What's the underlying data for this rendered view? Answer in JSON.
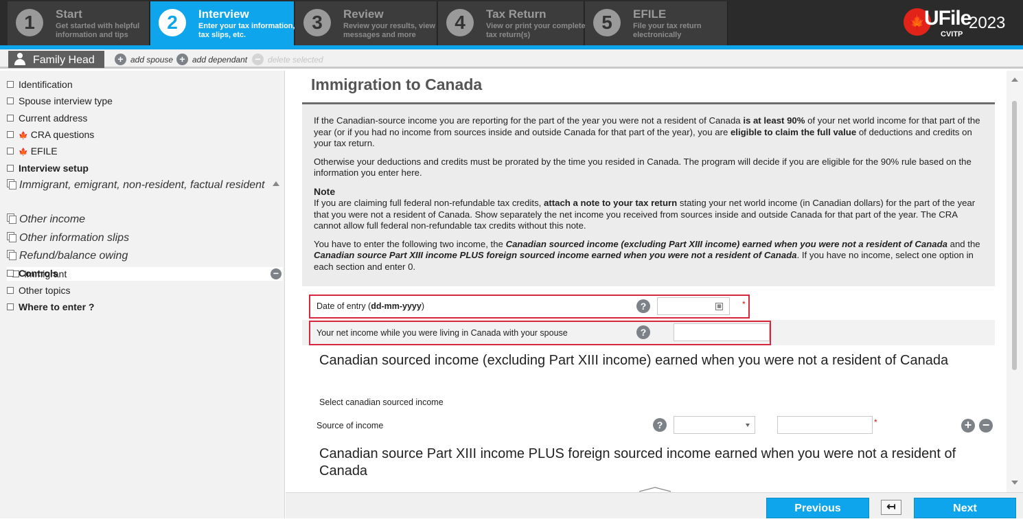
{
  "steps": [
    {
      "num": "1",
      "title": "Start",
      "desc": "Get started with helpful information and tips"
    },
    {
      "num": "2",
      "title": "Interview",
      "desc": "Enter your tax information, tax slips, etc."
    },
    {
      "num": "3",
      "title": "Review",
      "desc": "Review your results, view messages and more"
    },
    {
      "num": "4",
      "title": "Tax Return",
      "desc": "View or print your complete tax return(s)"
    },
    {
      "num": "5",
      "title": "EFILE",
      "desc": "File your tax return electronically"
    }
  ],
  "logo": {
    "brand": "UFile",
    "year": "2023",
    "edition": "CVITP",
    "leaf": "🍁"
  },
  "family": {
    "tab_label": "Family Head",
    "add_spouse": "add spouse",
    "add_dependant": "add dependant",
    "delete_selected": "delete selected"
  },
  "sidebar": {
    "identification": "Identification",
    "spouse_interview_type": "Spouse interview type",
    "current_address": "Current address",
    "cra_questions": "CRA questions",
    "efile": "EFILE",
    "interview_setup": "Interview setup",
    "immigrant_group": "Immigrant, emigrant, non-resident, factual resident",
    "immigrant": "Immigrant",
    "other_income": "Other income",
    "other_info_slips": "Other information slips",
    "refund_balance": "Refund/balance owing",
    "controls": "Controls",
    "other_topics": "Other topics",
    "where_to_enter": "Where to enter ?"
  },
  "main": {
    "title": "Immigration to Canada",
    "info": {
      "p1_a": "If the Canadian-source income you are reporting for the part of the year you were not a resident of Canada ",
      "p1_b": "is at least 90%",
      "p1_c": " of your net world income for that part of the year (or if you had no income from sources inside and outside Canada for that part of the year), you are ",
      "p1_d": "eligible to claim the full value",
      "p1_e": " of deductions and credits on your tax return.",
      "p2": "Otherwise your deductions and credits must be prorated by the time you resided in Canada. The program will decide if you are eligible for the 90% rule based on the information you enter here.",
      "note_title": "Note",
      "p3_a": " If you are claiming full federal non-refundable tax credits, ",
      "p3_b": "attach a note to your tax return",
      "p3_c": " stating your net world income (in Canadian dollars) for the part of the year that you were not a resident of Canada. Show separately the net income you received from sources inside and outside Canada for that part of the year. The CRA cannot allow full federal non-refundable tax credits without this note.",
      "p4_a": "You have to enter the following two income, the ",
      "p4_b": "Canadian sourced income (excluding Part XIII income) earned when you were not a resident of Canada",
      "p4_c": " and the ",
      "p4_d": "Canadian source Part XIII income PLUS foreign sourced income earned when you were not a resident of Canada",
      "p4_e": ". If you have no income, select one option in each section and enter 0."
    },
    "date_of_entry_label_a": "Date of entry (",
    "date_of_entry_label_b": "dd-mm-yyyy",
    "date_of_entry_label_c": ")",
    "date_of_entry_value": "",
    "net_income_label": "Your net income while you were living in Canada with your spouse",
    "net_income_value": "",
    "section1_title": "Canadian sourced income (excluding Part XIII income) earned when you were not a resident of Canada",
    "section1_subtitle": "Select canadian sourced income",
    "source_of_income_label": "Source of income",
    "source_select_value": "",
    "source_amount_value": "",
    "section2_title": "Canadian source Part XIII income PLUS foreign sourced income earned when you were not a resident of Canada",
    "help_glyph": "?",
    "required_mark": "*"
  },
  "bottom": {
    "previous": "Previous",
    "next": "Next",
    "back_glyph": "↤"
  },
  "colors": {
    "accent": "#0ea5ec",
    "highlight_border": "#d7263d",
    "topbar": "#2b2b2b"
  }
}
